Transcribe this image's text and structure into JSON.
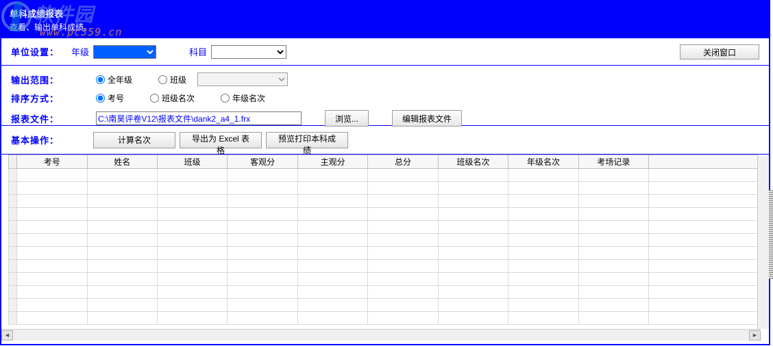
{
  "watermark": {
    "text": "软件园",
    "url": "www.pc359.cn"
  },
  "titlebar": {
    "title": "单科成绩报表",
    "subtitle": "查看、输出单科成绩。"
  },
  "settings": {
    "section_label": "单位设置：",
    "grade_label": "年级",
    "grade_value": "",
    "subject_label": "科目",
    "subject_value": "",
    "close_button": "关闭窗口"
  },
  "range": {
    "scope_label": "输出范围：",
    "scope_all": "全年级",
    "scope_class": "班级",
    "scope_class_value": "",
    "sort_label": "排序方式：",
    "sort_examno": "考号",
    "sort_classrank": "班级名次",
    "sort_graderank": "年级名次",
    "file_label": "报表文件：",
    "file_value": "C:\\南昊评卷V12\\报表文件\\dank2_a4_1.frx",
    "browse_btn": "浏览...",
    "edit_btn": "编辑报表文件"
  },
  "ops": {
    "section_label": "基本操作：",
    "calc_btn": "计算名次",
    "export_btn": "导出为 Excel 表格",
    "preview_btn": "预览打印本科成绩"
  },
  "table": {
    "columns": [
      "",
      "考号",
      "姓名",
      "班级",
      "客观分",
      "主观分",
      "总分",
      "班级名次",
      "年级名次",
      "考场记录",
      ""
    ],
    "row_count": 12
  }
}
